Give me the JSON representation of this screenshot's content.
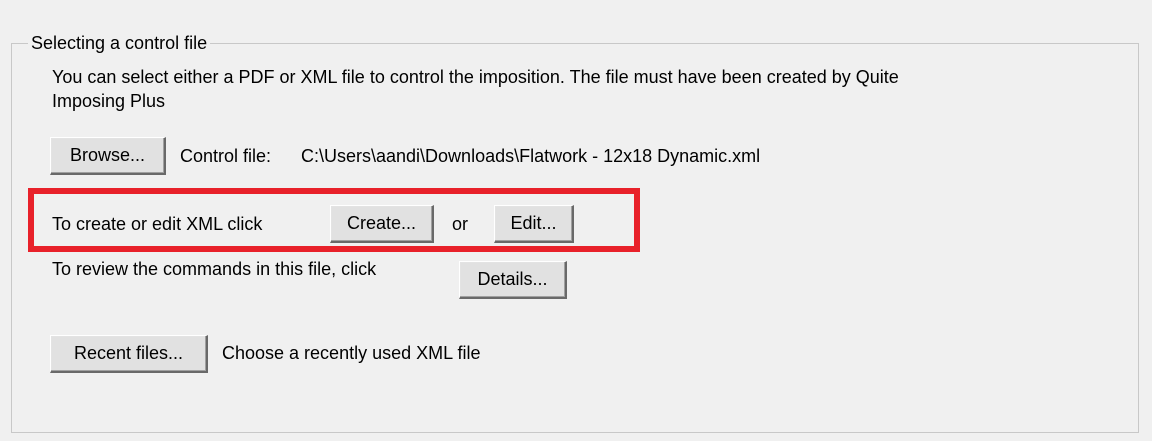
{
  "group": {
    "title": "Selecting a control file"
  },
  "intro": {
    "line1": "You can select either a PDF or XML file to control the imposition. The file must have been created by Quite",
    "line2": "Imposing Plus"
  },
  "browse": {
    "button_label": "Browse...",
    "field_label": "Control file:",
    "file_path": "C:\\Users\\aandi\\Downloads\\Flatwork - 12x18 Dynamic.xml"
  },
  "xml_edit": {
    "prompt": "To create or edit XML click",
    "create_label": "Create...",
    "or_text": "or",
    "edit_label": "Edit..."
  },
  "details": {
    "prompt": "To review the commands in this file, click",
    "button_label": "Details..."
  },
  "recent": {
    "button_label": "Recent files...",
    "description": "Choose a recently used XML file"
  },
  "annotation": {
    "highlight_color": "#e8212a"
  }
}
